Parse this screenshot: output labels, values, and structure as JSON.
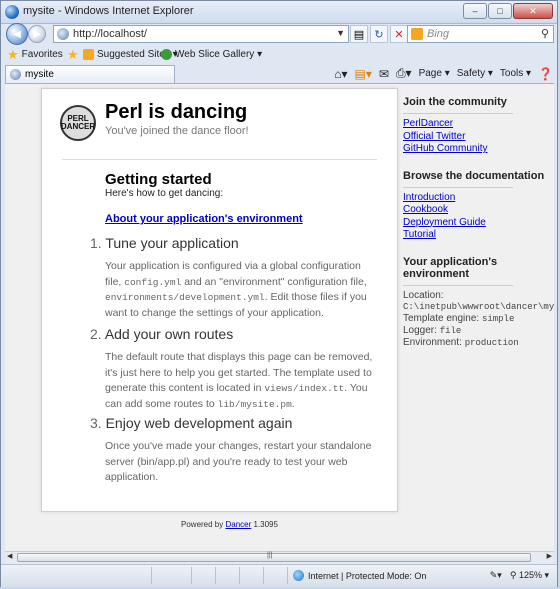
{
  "window": {
    "title": "mysite - Windows Internet Explorer",
    "minimize": "–",
    "maximize": "□",
    "close": "✕"
  },
  "nav": {
    "url": "http://localhost/",
    "search_placeholder": "Bing",
    "back_icon": "back-arrow-icon",
    "forward_icon": "forward-arrow-icon"
  },
  "favorites": {
    "label": "Favorites",
    "items": [
      "Suggested Sites ▾",
      "Web Slice Gallery ▾"
    ]
  },
  "tab": {
    "label": "mysite"
  },
  "commandbar": {
    "page": "Page ▾",
    "safety": "Safety ▾",
    "tools": "Tools ▾"
  },
  "page": {
    "logo_top": "PERL",
    "logo_bottom": "DANCER",
    "title": "Perl is dancing",
    "subtitle": "You've joined the dance floor!",
    "getting_started_title": "Getting started",
    "getting_started_sub": "Here's how to get dancing:",
    "env_link": "About your application's environment",
    "steps": [
      {
        "num": "1.",
        "title": "Tune your application"
      },
      {
        "num": "2.",
        "title": "Add your own routes"
      },
      {
        "num": "3.",
        "title": "Enjoy web development again"
      }
    ],
    "step1_text": [
      "Your application is configured via a global configuration file, ",
      "config.yml",
      " and an \"environment\" configuration file, ",
      "environments/development.yml",
      ". Edit those files if you want to change the settings of your application."
    ],
    "step2_text": [
      "The default route that displays this page can be removed, it's just here to help you get started. The template used to generate this content is located in ",
      "views/index.tt",
      ". You can add some routes to ",
      "lib/mysite.pm",
      "."
    ],
    "step3_text": "Once you've made your changes, restart your standalone server (bin/app.pl) and you're ready to test your web application."
  },
  "sidebar": {
    "community_title": "Join the community",
    "community_links": [
      "PerlDancer",
      "Official Twitter",
      "GitHub Community"
    ],
    "docs_title": "Browse the documentation",
    "docs_links": [
      "Introduction",
      "Cookbook",
      "Deployment Guide",
      "Tutorial"
    ],
    "env_title": "Your application's environment",
    "location_label": "Location:",
    "location_value": "C:\\inetpub\\wwwroot\\dancer\\mys",
    "template_label": "Template engine: ",
    "template_value": "simple",
    "logger_label": "Logger: ",
    "logger_value": "file",
    "environment_label": "Environment: ",
    "environment_value": "production"
  },
  "footer": {
    "prefix": "Powered by ",
    "link": "Dancer",
    "version": " 1.3095"
  },
  "status": {
    "zone": "Internet | Protected Mode: On",
    "zoom": "125%"
  }
}
